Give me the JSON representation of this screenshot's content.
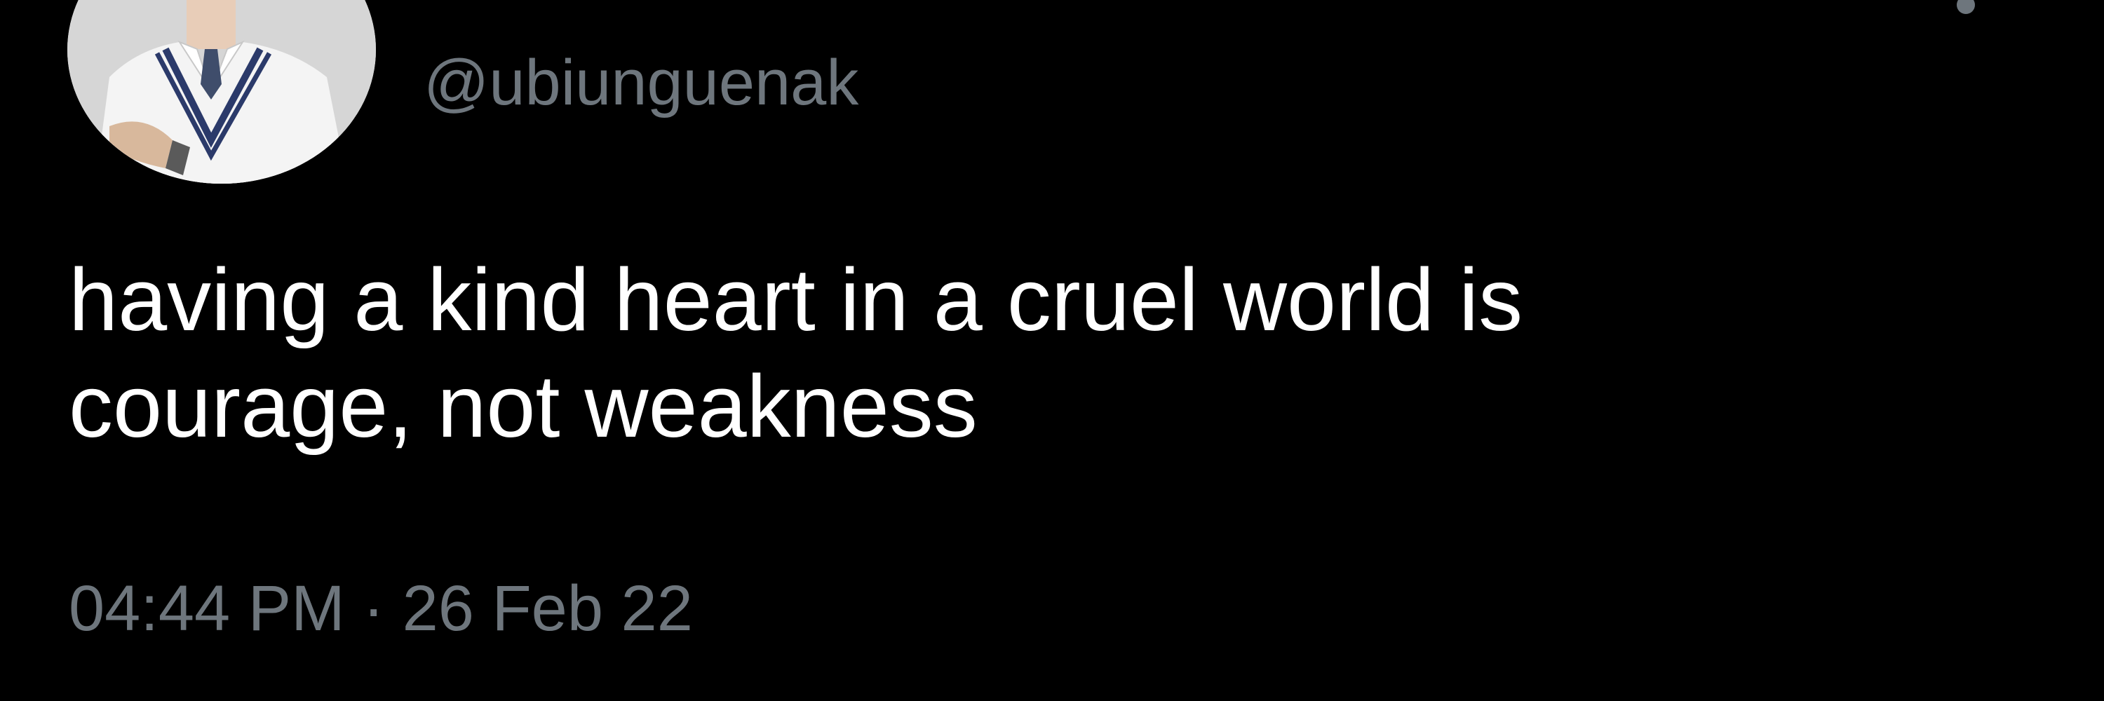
{
  "tweet": {
    "handle": "@ubiunguenak",
    "text": "having a kind heart in a cruel world is\ncourage, not weakness",
    "time": "04:44 PM",
    "separator": "·",
    "date": "26 Feb 22"
  },
  "colors": {
    "background": "#000000",
    "text_primary": "#ffffff",
    "text_secondary": "#6e767d"
  },
  "icons": {
    "more": "more-options-icon"
  }
}
